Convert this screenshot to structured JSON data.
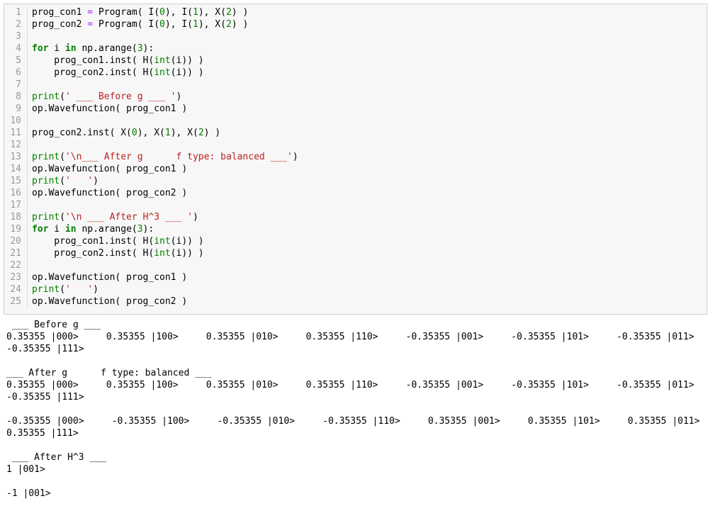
{
  "code_lines": [
    {
      "n": "1",
      "tokens": [
        [
          "plain",
          "prog_con1 "
        ],
        [
          "op",
          "="
        ],
        [
          "plain",
          " Program( I("
        ],
        [
          "num",
          "0"
        ],
        [
          "plain",
          "), I("
        ],
        [
          "num",
          "1"
        ],
        [
          "plain",
          "), X("
        ],
        [
          "num",
          "2"
        ],
        [
          "plain",
          ") )"
        ]
      ]
    },
    {
      "n": "2",
      "tokens": [
        [
          "plain",
          "prog_con2 "
        ],
        [
          "op",
          "="
        ],
        [
          "plain",
          " Program( I("
        ],
        [
          "num",
          "0"
        ],
        [
          "plain",
          "), I("
        ],
        [
          "num",
          "1"
        ],
        [
          "plain",
          "), X("
        ],
        [
          "num",
          "2"
        ],
        [
          "plain",
          ") )"
        ]
      ]
    },
    {
      "n": "3",
      "tokens": []
    },
    {
      "n": "4",
      "tokens": [
        [
          "kw",
          "for"
        ],
        [
          "plain",
          " i "
        ],
        [
          "kw",
          "in"
        ],
        [
          "plain",
          " np.arange("
        ],
        [
          "num",
          "3"
        ],
        [
          "plain",
          "):"
        ]
      ]
    },
    {
      "n": "5",
      "tokens": [
        [
          "plain",
          "    prog_con1.inst( H("
        ],
        [
          "builtin",
          "int"
        ],
        [
          "plain",
          "(i)) )"
        ]
      ]
    },
    {
      "n": "6",
      "tokens": [
        [
          "plain",
          "    prog_con2.inst( H("
        ],
        [
          "builtin",
          "int"
        ],
        [
          "plain",
          "(i)) )"
        ]
      ]
    },
    {
      "n": "7",
      "tokens": []
    },
    {
      "n": "8",
      "tokens": [
        [
          "builtin",
          "print"
        ],
        [
          "plain",
          "("
        ],
        [
          "str",
          "' ___ Before g ___ '"
        ],
        [
          "plain",
          ")"
        ]
      ]
    },
    {
      "n": "9",
      "tokens": [
        [
          "plain",
          "op.Wavefunction( prog_con1 )"
        ]
      ]
    },
    {
      "n": "10",
      "tokens": []
    },
    {
      "n": "11",
      "tokens": [
        [
          "plain",
          "prog_con2.inst( X("
        ],
        [
          "num",
          "0"
        ],
        [
          "plain",
          "), X("
        ],
        [
          "num",
          "1"
        ],
        [
          "plain",
          "), X("
        ],
        [
          "num",
          "2"
        ],
        [
          "plain",
          ") )"
        ]
      ]
    },
    {
      "n": "12",
      "tokens": []
    },
    {
      "n": "13",
      "tokens": [
        [
          "builtin",
          "print"
        ],
        [
          "plain",
          "("
        ],
        [
          "str",
          "'\\n___ After g      f type: balanced ___'"
        ],
        [
          "plain",
          ")"
        ]
      ]
    },
    {
      "n": "14",
      "tokens": [
        [
          "plain",
          "op.Wavefunction( prog_con1 )"
        ]
      ]
    },
    {
      "n": "15",
      "tokens": [
        [
          "builtin",
          "print"
        ],
        [
          "plain",
          "("
        ],
        [
          "str",
          "'   '"
        ],
        [
          "plain",
          ")"
        ]
      ]
    },
    {
      "n": "16",
      "tokens": [
        [
          "plain",
          "op.Wavefunction( prog_con2 )"
        ]
      ]
    },
    {
      "n": "17",
      "tokens": []
    },
    {
      "n": "18",
      "tokens": [
        [
          "builtin",
          "print"
        ],
        [
          "plain",
          "("
        ],
        [
          "str",
          "'\\n ___ After H^3 ___ '"
        ],
        [
          "plain",
          ")"
        ]
      ]
    },
    {
      "n": "19",
      "tokens": [
        [
          "kw",
          "for"
        ],
        [
          "plain",
          " i "
        ],
        [
          "kw",
          "in"
        ],
        [
          "plain",
          " np.arange("
        ],
        [
          "num",
          "3"
        ],
        [
          "plain",
          "):"
        ]
      ]
    },
    {
      "n": "20",
      "tokens": [
        [
          "plain",
          "    prog_con1.inst( H("
        ],
        [
          "builtin",
          "int"
        ],
        [
          "plain",
          "(i)) )"
        ]
      ]
    },
    {
      "n": "21",
      "tokens": [
        [
          "plain",
          "    prog_con2.inst( H("
        ],
        [
          "builtin",
          "int"
        ],
        [
          "plain",
          "(i)) )"
        ]
      ]
    },
    {
      "n": "22",
      "tokens": []
    },
    {
      "n": "23",
      "tokens": [
        [
          "plain",
          "op.Wavefunction( prog_con1 )"
        ]
      ]
    },
    {
      "n": "24",
      "tokens": [
        [
          "builtin",
          "print"
        ],
        [
          "plain",
          "("
        ],
        [
          "str",
          "'   '"
        ],
        [
          "plain",
          ")"
        ]
      ]
    },
    {
      "n": "25",
      "tokens": [
        [
          "plain",
          "op.Wavefunction( prog_con2 )"
        ]
      ]
    }
  ],
  "output_lines": [
    " ___ Before g ___",
    "0.35355 |000>     0.35355 |100>     0.35355 |010>     0.35355 |110>     -0.35355 |001>     -0.35355 |101>     -0.35355 |011>",
    "-0.35355 |111>",
    "",
    "___ After g      f type: balanced ___",
    "0.35355 |000>     0.35355 |100>     0.35355 |010>     0.35355 |110>     -0.35355 |001>     -0.35355 |101>     -0.35355 |011>",
    "-0.35355 |111>",
    "",
    "-0.35355 |000>     -0.35355 |100>     -0.35355 |010>     -0.35355 |110>     0.35355 |001>     0.35355 |101>     0.35355 |011>",
    "0.35355 |111>",
    "",
    " ___ After H^3 ___",
    "1 |001>",
    "",
    "-1 |001>"
  ]
}
